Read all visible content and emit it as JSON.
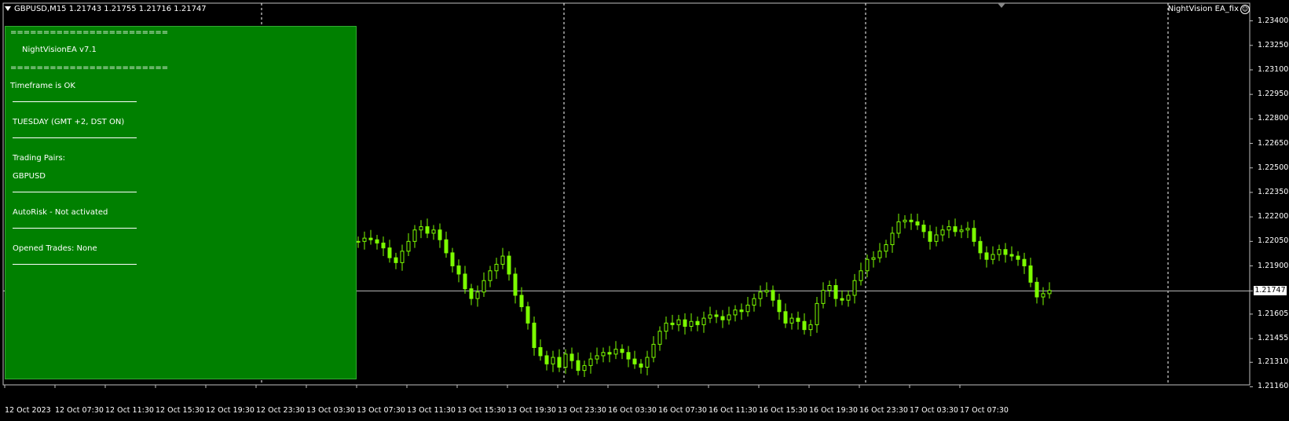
{
  "header": {
    "symbol_info": "GBPUSD,M15  1.21743 1.21755 1.21716 1.21747",
    "ea_name": "NightVision EA_fix"
  },
  "info_panel": {
    "sep1": "========================",
    "title": "NightVisionEA  v7.1",
    "sep2": "========================",
    "timeframe": "Timeframe is OK",
    "day": "TUESDAY    (GMT +2, DST ON)",
    "pairs_label": "Trading Pairs:",
    "pair": "GBPUSD",
    "autorisk": "AutoRisk - Not activated",
    "opened_trades": "Opened Trades: None"
  },
  "price_axis": [
    "1.23400",
    "1.23250",
    "1.23100",
    "1.22950",
    "1.22800",
    "1.22650",
    "1.22500",
    "1.22350",
    "1.22200",
    "1.22050",
    "1.21900",
    "1.21747",
    "1.21605",
    "1.21455",
    "1.21310",
    "1.21160"
  ],
  "current_price": "1.21747",
  "time_axis": [
    "12 Oct 2023",
    "12 Oct 07:30",
    "12 Oct 11:30",
    "12 Oct 15:30",
    "12 Oct 19:30",
    "12 Oct 23:30",
    "13 Oct 03:30",
    "13 Oct 07:30",
    "13 Oct 11:30",
    "13 Oct 15:30",
    "13 Oct 19:30",
    "13 Oct 23:30",
    "16 Oct 03:30",
    "16 Oct 07:30",
    "16 Oct 11:30",
    "16 Oct 15:30",
    "16 Oct 19:30",
    "16 Oct 23:30",
    "17 Oct 03:30",
    "17 Oct 07:30"
  ],
  "colors": {
    "background": "#000000",
    "candles": "#7CFC00",
    "panel": "#008000",
    "grid": "#ffffff"
  },
  "chart_data": {
    "type": "line",
    "title": "GBPUSD,M15",
    "ylim": [
      1.2109,
      1.2347
    ],
    "series": [
      {
        "values": [
          1.2205,
          1.2207,
          1.2206,
          1.2204,
          1.2201,
          1.2195,
          1.2192,
          1.2199,
          1.2205,
          1.2212,
          1.2214,
          1.221,
          1.2212,
          1.2206,
          1.2198,
          1.219,
          1.2185,
          1.2176,
          1.217,
          1.2174,
          1.2181,
          1.2187,
          1.2191,
          1.2196,
          1.2185,
          1.2172,
          1.2165,
          1.2155,
          1.214,
          1.2135,
          1.213,
          1.2134,
          1.2128,
          1.2136,
          1.2132,
          1.2126,
          1.2129,
          1.2133,
          1.2135,
          1.2137,
          1.2136,
          1.2139,
          1.2137,
          1.2133,
          1.213,
          1.2128,
          1.2134,
          1.2142,
          1.215,
          1.2155,
          1.2154,
          1.2157,
          1.2153,
          1.2156,
          1.2154,
          1.2158,
          1.216,
          1.2159,
          1.2157,
          1.216,
          1.2163,
          1.2162,
          1.2166,
          1.217,
          1.2174,
          1.2175,
          1.2169,
          1.2162,
          1.2155,
          1.2158,
          1.2156,
          1.2151,
          1.2154,
          1.2167,
          1.2175,
          1.2178,
          1.217,
          1.2169,
          1.2172,
          1.2181,
          1.2187,
          1.2194,
          1.2195,
          1.2199,
          1.2203,
          1.221,
          1.2217,
          1.2218,
          1.2217,
          1.2215,
          1.2211,
          1.2205,
          1.2209,
          1.2212,
          1.2214,
          1.2211,
          1.2212,
          1.2213,
          1.2205,
          1.2198,
          1.2194,
          1.2197,
          1.22,
          1.2197,
          1.2196,
          1.2194,
          1.219,
          1.218,
          1.2171,
          1.2173,
          1.2175
        ]
      }
    ]
  }
}
